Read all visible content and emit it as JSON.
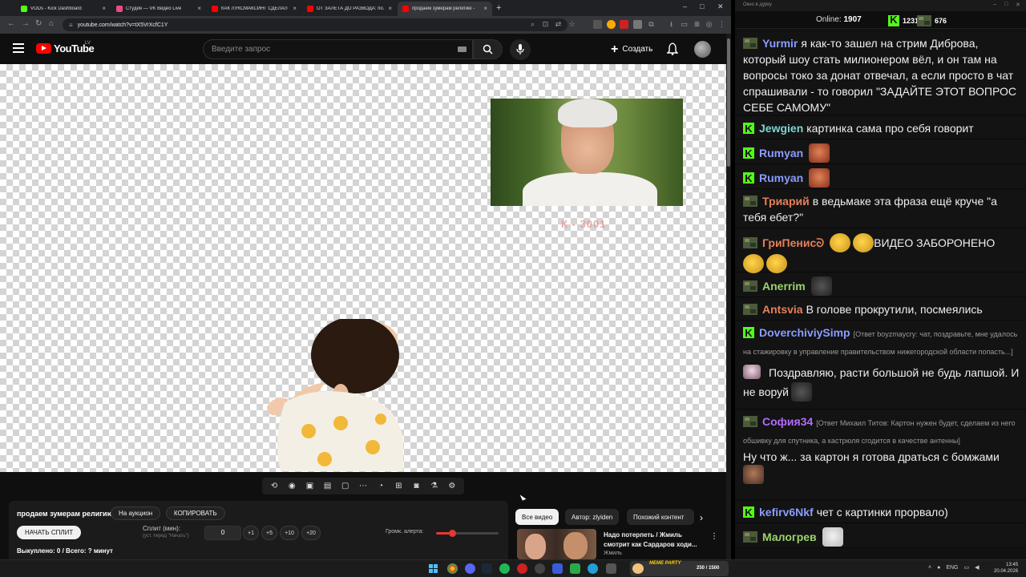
{
  "browser": {
    "tabs": [
      {
        "title": "VODs - Kick Dashboard",
        "favicon_color": "#53fc18",
        "active": false
      },
      {
        "title": "Студия — VK Видео Live",
        "favicon_color": "#e84a8c",
        "active": false
      },
      {
        "title": "КАК ЛУКСМАКСИНГ СДЕЛАЛ",
        "favicon_color": "#ff0000",
        "active": false
      },
      {
        "title": "ОТ ЗАЛЕТА ДО РАЗВОДА: по...",
        "favicon_color": "#ff0000",
        "active": false
      },
      {
        "title": "продаем зумерам религию - ",
        "favicon_color": "#ff0000",
        "active": true
      }
    ],
    "new_tab": "+",
    "window_controls": {
      "minimize": "–",
      "maximize": "□",
      "close": "✕"
    },
    "url": "youtube.com/watch?v=tX5VrXcfC1Y"
  },
  "youtube": {
    "logo_text": "YouTube",
    "country": "LV",
    "search_placeholder": "Введите запрос",
    "create_label": "Создать",
    "create_plus": "+",
    "search_symbol": "⌕"
  },
  "player": {
    "overlay_caption": "К - 3001"
  },
  "extension": {
    "icons": [
      "repeat-icon",
      "live-icon",
      "screen-record-icon",
      "film-icon",
      "fullscreen-icon",
      "dashed-rect-icon",
      "speed-icon",
      "plus-box-icon",
      "camera-icon",
      "flask-icon",
      "gear-icon"
    ],
    "icon_glyphs": [
      "⟲",
      "◉",
      "▣",
      "▤",
      "▢",
      "⋯",
      "◔",
      "⊞",
      "◙",
      "⚗",
      "⚙"
    ],
    "title": "продаем зумерам религию",
    "auction_label": "На аукцион",
    "copy_label": "КОПИРОВАТЬ",
    "start_split_label": "НАЧАТЬ СПЛИТ",
    "split_label": "Сплит (мин):",
    "split_sub": "(уст. перед \"Начать\")",
    "split_value": "0",
    "steps": [
      "+1",
      "+5",
      "+10",
      "+20"
    ],
    "alert_volume_label": "Громк. алерта:",
    "alert_volume_level": 0.25,
    "sold_text": "Выкуплено: 0 / Всего: ? минут"
  },
  "recommendations": {
    "chips": [
      "Все видео",
      "Автор: zlyiden",
      "Похожий контент"
    ],
    "next_symbol": "›",
    "video_title": "Надо потерпеть / Жмиль смотрит как Сардаров ходи...",
    "video_channel": "Жмиль",
    "more_symbol": "⋮"
  },
  "chat": {
    "window_title": "Окно в дурку",
    "online_label": "Online:",
    "online_count": "1907",
    "k_count": "1231",
    "kick_count": "676",
    "messages": [
      {
        "nick": "Yurmir",
        "nick_color": "#8a9cff",
        "badge": "camo",
        "text": "я как-то зашел на стрим Диброва, который шоу стать милионером вёл, и он там на вопросы токо за донат отвечал, а если просто в чат спрашивали - то говорил \"ЗАДАЙТЕ ЭТОТ ВОПРОС СЕБЕ САМОМУ\""
      },
      {
        "nick": "Jewgien",
        "nick_color": "#7fd3d3",
        "badge": "kick",
        "text": "картинка сама про себя говорит"
      },
      {
        "nick": "Rumyan",
        "nick_color": "#8a9cff",
        "badge": "kick",
        "text": "",
        "emotes": [
          "face-red"
        ]
      },
      {
        "nick": "Rumyan",
        "nick_color": "#8a9cff",
        "badge": "kick",
        "text": "",
        "emotes": [
          "face-red"
        ]
      },
      {
        "nick": "Триарий",
        "nick_color": "#e5805a",
        "badge": "camo",
        "text": "в ведьмаке эта фраза ещё круче \"а тебя ебет?\""
      },
      {
        "nick": "ГриПенисᘐ",
        "nick_color": "#e5805a",
        "badge": "camo",
        "text": "ВИДЕО ЗАБОРОНЕНО",
        "emotes": [
          "thinking",
          "thinking",
          "thinking",
          "thinking"
        ]
      },
      {
        "nick": "Anerrim",
        "nick_color": "#9bd36b",
        "badge": "camo",
        "text": "",
        "emotes": [
          "dark"
        ]
      },
      {
        "nick": "Antsvia",
        "nick_color": "#e5805a",
        "badge": "camo",
        "text": "В голове прокрутили, посмеялись"
      },
      {
        "nick": "DoverchiviySimp",
        "nick_color": "#8a9cff",
        "badge": "kick",
        "reply": "[Ответ boyzmaycry: чат, поздравьте, мне удалось на стажировку в управление правительством нижегородской области попасть...]",
        "text": "Поздравляю, расти большой не будь лапшой. И не воруй",
        "emotes": [
          "dark"
        ]
      },
      {
        "nick": "София34",
        "nick_color": "#b46bff",
        "badge": "camo",
        "reply": "[Ответ Михаил Титов: Картон нужен будет, сделаем из него обшивку для спутника, а кастрюля сгодится в качестве антенны]",
        "text": "Ну что ж... за картон я готова драться с бомжами",
        "emotes": [
          "face-man"
        ]
      },
      {
        "nick": "kefirv6Nkf",
        "nick_color": "#8a9cff",
        "badge": "kick",
        "text": "чет с картинки прорвало)"
      },
      {
        "nick": "Малогрев",
        "nick_color": "#9bd36b",
        "badge": "camo",
        "text": "",
        "emotes": [
          "cat"
        ]
      }
    ]
  },
  "taskbar": {
    "meme_label": "MEME PARTY",
    "meme_count": "250 / 1500",
    "lang": "ENG",
    "time": "13:45",
    "date": "20.04.2026"
  }
}
